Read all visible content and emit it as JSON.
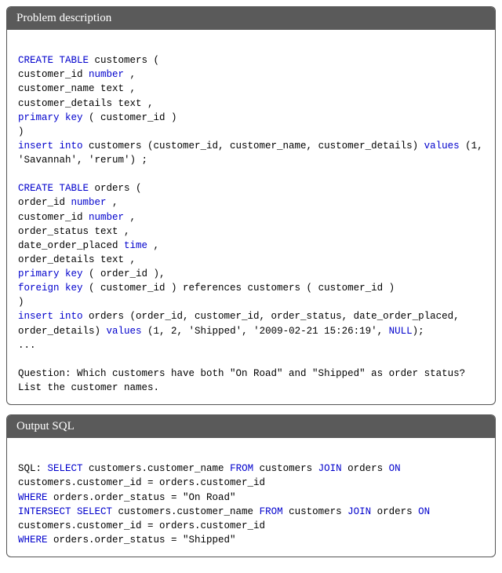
{
  "problem": {
    "title": "Problem description",
    "lines": [
      "",
      {
        "t": "CREATE TABLE",
        "k": true,
        "r": " customers ("
      },
      {
        "t": "customer_id ",
        "r2": "number",
        "k2": true,
        "r3": " ,"
      },
      "customer_name text ,",
      "customer_details text ,",
      {
        "t": "primary key",
        "k": true,
        "r": " ( customer_id )"
      },
      ")",
      {
        "parts": [
          {
            "t": "insert into",
            "k": true
          },
          {
            "t": " customers (customer_id, customer_name, customer_details) "
          },
          {
            "t": "values",
            "k": true
          },
          {
            "t": " (1, 'Savannah', 'rerum') ;"
          }
        ]
      },
      "",
      {
        "t": "CREATE TABLE",
        "k": true,
        "r": " orders ("
      },
      {
        "t": "order_id ",
        "r2": "number",
        "k2": true,
        "r3": " ,"
      },
      {
        "t": "customer_id ",
        "r2": "number",
        "k2": true,
        "r3": " ,"
      },
      "order_status text ,",
      {
        "t": "date_order_placed ",
        "r2": "time",
        "k2": true,
        "r3": " ,"
      },
      "order_details text ,",
      {
        "t": "primary key",
        "k": true,
        "r": " ( order_id ),"
      },
      {
        "t": "foreign key",
        "k": true,
        "r": " ( customer_id ) references customers ( customer_id )"
      },
      ")",
      {
        "parts": [
          {
            "t": "insert into",
            "k": true
          },
          {
            "t": " orders (order_id, customer_id, order_status, date_order_placed, order_details) "
          },
          {
            "t": "values",
            "k": true
          },
          {
            "t": " (1, 2, 'Shipped', '2009-02-21 15:26:19', "
          },
          {
            "t": "NULL",
            "k": true
          },
          {
            "t": ");"
          }
        ]
      },
      "...",
      "",
      "Question: Which customers have both \"On Road\" and \"Shipped\" as order status? List the customer names."
    ]
  },
  "output": {
    "title": "Output SQL",
    "lines": [
      "",
      {
        "parts": [
          {
            "t": "SQL: "
          },
          {
            "t": "SELECT",
            "k": true
          },
          {
            "t": " customers.customer_name "
          },
          {
            "t": "FROM",
            "k": true
          },
          {
            "t": " customers "
          },
          {
            "t": "JOIN",
            "k": true
          },
          {
            "t": " orders "
          },
          {
            "t": "ON",
            "k": true
          },
          {
            "t": " customers.customer_id = orders.customer_id"
          }
        ]
      },
      {
        "parts": [
          {
            "t": "WHERE",
            "k": true
          },
          {
            "t": " orders.order_status = \"On Road\""
          }
        ]
      },
      {
        "parts": [
          {
            "t": "INTERSECT SELECT",
            "k": true
          },
          {
            "t": " customers.customer_name "
          },
          {
            "t": "FROM",
            "k": true
          },
          {
            "t": " customers "
          },
          {
            "t": "JOIN",
            "k": true
          },
          {
            "t": " orders "
          },
          {
            "t": "ON",
            "k": true
          },
          {
            "t": " customers.customer_id = orders.customer_id"
          }
        ]
      },
      {
        "parts": [
          {
            "t": "WHERE",
            "k": true
          },
          {
            "t": " orders.order_status = \"Shipped\""
          }
        ]
      }
    ]
  }
}
